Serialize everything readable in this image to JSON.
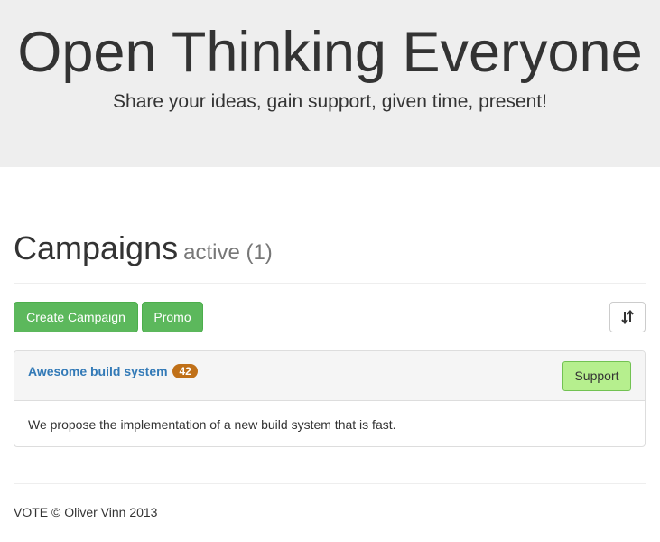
{
  "jumbotron": {
    "title": "Open Thinking Everyone",
    "tagline": "Share your ideas, gain support, given time, present!"
  },
  "campaigns": {
    "heading": "Campaigns",
    "status": "active (1)"
  },
  "toolbar": {
    "create_label": "Create Campaign",
    "promo_label": "Promo",
    "sort_icon": "sort-icon"
  },
  "campaign_list": [
    {
      "title": "Awesome build system",
      "votes": "42",
      "support_label": "Support",
      "description": "We propose the implementation of a new build system that is fast."
    }
  ],
  "footer": {
    "text": "VOTE © Oliver Vinn 2013"
  },
  "colors": {
    "success": "#5cb85c",
    "link": "#337ab7",
    "badge": "#c07018",
    "support": "#b6ef8e"
  }
}
